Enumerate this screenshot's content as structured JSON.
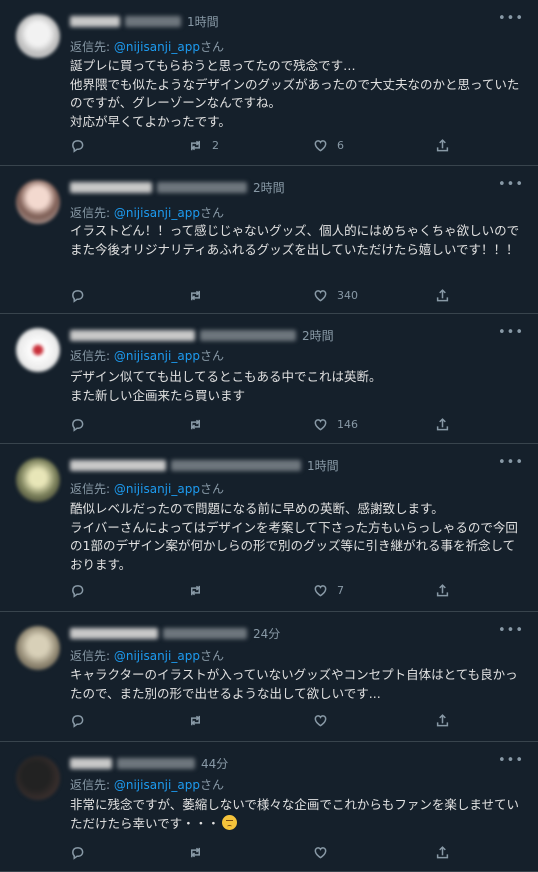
{
  "tweets": [
    {
      "time": "1時間",
      "reply_prefix": "返信先: ",
      "reply_to": "@nijisanji_app",
      "reply_suffix": "さん",
      "body": "誕プレに買ってもらおうと思ってたので残念です…\n他界隈でも似たようなデザインのグッズがあったので大丈夫なのかと思っていたのですが、グレーゾーンなんですね。\n対応が早くてよかったです。",
      "retweets": "2",
      "likes": "6"
    },
    {
      "time": "2時間",
      "reply_prefix": "返信先: ",
      "reply_to": "@nijisanji_app",
      "reply_suffix": "さん",
      "body": "イラストどん！！って感じじゃないグッズ、個人的にはめちゃくちゃ欲しいのでまた今後オリジナリティあふれるグッズを出していただけたら嬉しいです！！！",
      "retweets": "",
      "likes": "340"
    },
    {
      "time": "2時間",
      "reply_prefix": "返信先: ",
      "reply_to": "@nijisanji_app",
      "reply_suffix": "さん",
      "body": "デザイン似てても出してるとこもある中でこれは英断。\nまた新しい企画来たら買います",
      "retweets": "",
      "likes": "146"
    },
    {
      "time": "1時間",
      "reply_prefix": "返信先: ",
      "reply_to": "@nijisanji_app",
      "reply_suffix": "さん",
      "body": "酷似レベルだったので問題になる前に早めの英断、感謝致します。\nライバーさんによってはデザインを考案して下さった方もいらっしゃるので今回の1部のデザイン案が何かしらの形で別のグッズ等に引き継がれる事を祈念しております。",
      "retweets": "",
      "likes": "7"
    },
    {
      "time": "24分",
      "reply_prefix": "返信先: ",
      "reply_to": "@nijisanji_app",
      "reply_suffix": "さん",
      "body": "キャラクターのイラストが入っていないグッズやコンセプト自体はとても良かったので、また別の形で出せるような出して欲しいです...",
      "retweets": "",
      "likes": ""
    },
    {
      "time": "44分",
      "reply_prefix": "返信先: ",
      "reply_to": "@nijisanji_app",
      "reply_suffix": "さん",
      "body": "非常に残念ですが、萎縮しないで様々な企画でこれからもファンを楽しませていただけたら幸いです・・・",
      "retweets": "",
      "likes": ""
    }
  ],
  "colors": {
    "background": "#15202b",
    "mention": "#1d9bf0",
    "meta_text": "#8899a6"
  },
  "icons": [
    "reply-icon",
    "retweet-icon",
    "like-icon",
    "share-icon",
    "more-icon",
    "worried-face-emoji"
  ]
}
